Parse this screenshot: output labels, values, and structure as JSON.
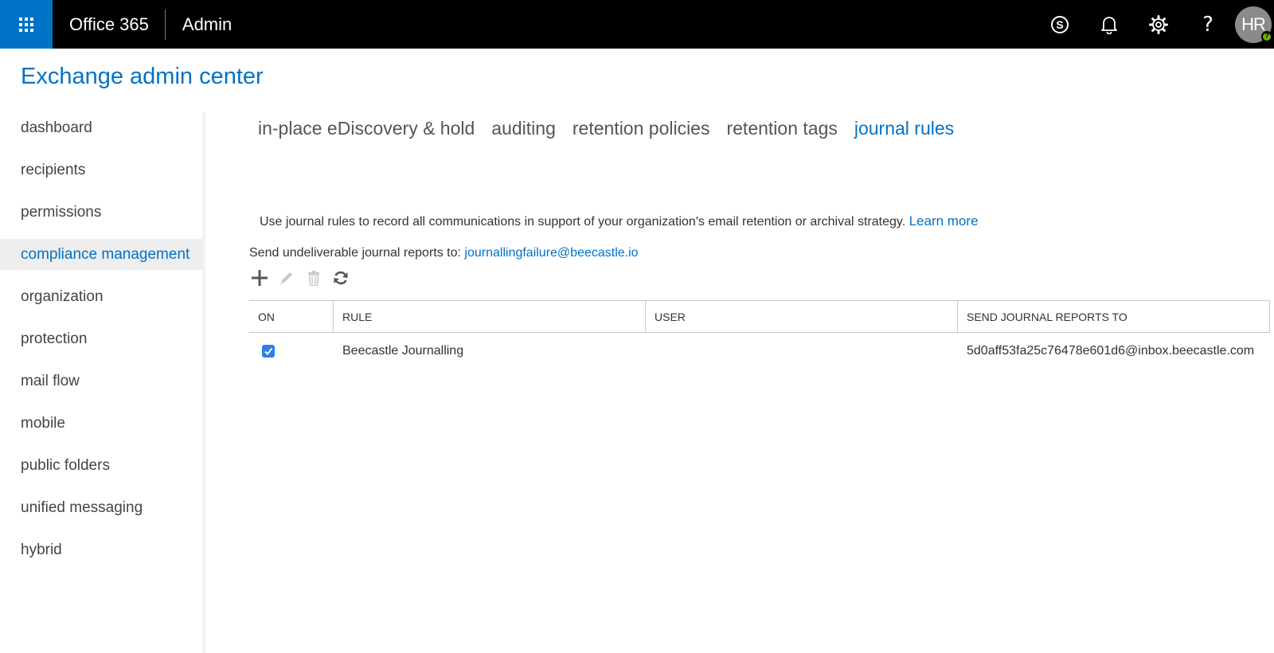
{
  "topbar": {
    "brand": "Office 365",
    "app": "Admin",
    "avatar_initials": "HR",
    "presence_glyph": "?",
    "icons": [
      "app-launcher-icon",
      "skype-icon",
      "bell-icon",
      "gear-icon",
      "help-icon"
    ],
    "help_glyph": "?"
  },
  "page": {
    "title": "Exchange admin center"
  },
  "sidebar": {
    "items": [
      {
        "label": "dashboard"
      },
      {
        "label": "recipients"
      },
      {
        "label": "permissions"
      },
      {
        "label": "compliance management",
        "active": true
      },
      {
        "label": "organization"
      },
      {
        "label": "protection"
      },
      {
        "label": "mail flow"
      },
      {
        "label": "mobile"
      },
      {
        "label": "public folders"
      },
      {
        "label": "unified messaging"
      },
      {
        "label": "hybrid"
      }
    ]
  },
  "tabs": [
    {
      "label": "in-place eDiscovery & hold"
    },
    {
      "label": "auditing"
    },
    {
      "label": "retention policies"
    },
    {
      "label": "retention tags"
    },
    {
      "label": "journal rules",
      "active": true
    }
  ],
  "main": {
    "description": "Use journal rules to record all communications in support of your organization's email retention or archival strategy.",
    "learn_more": "Learn more",
    "undeliverable_label": "Send undeliverable journal reports to:",
    "undeliverable_email": "journallingfailure@beecastle.io",
    "toolbar": [
      "add-icon",
      "edit-icon",
      "delete-icon",
      "refresh-icon"
    ]
  },
  "table": {
    "columns": [
      "ON",
      "RULE",
      "USER",
      "SEND JOURNAL REPORTS TO"
    ],
    "rows": [
      {
        "on": true,
        "rule": "Beecastle Journalling",
        "user": "",
        "send_to": "5d0aff53fa25c76478e601d6@inbox.beecastle.com"
      }
    ]
  },
  "colors": {
    "accent": "#0072c6",
    "topbar": "#000000",
    "checkbox": "#2f7ee6",
    "presence": "#6bb700"
  }
}
